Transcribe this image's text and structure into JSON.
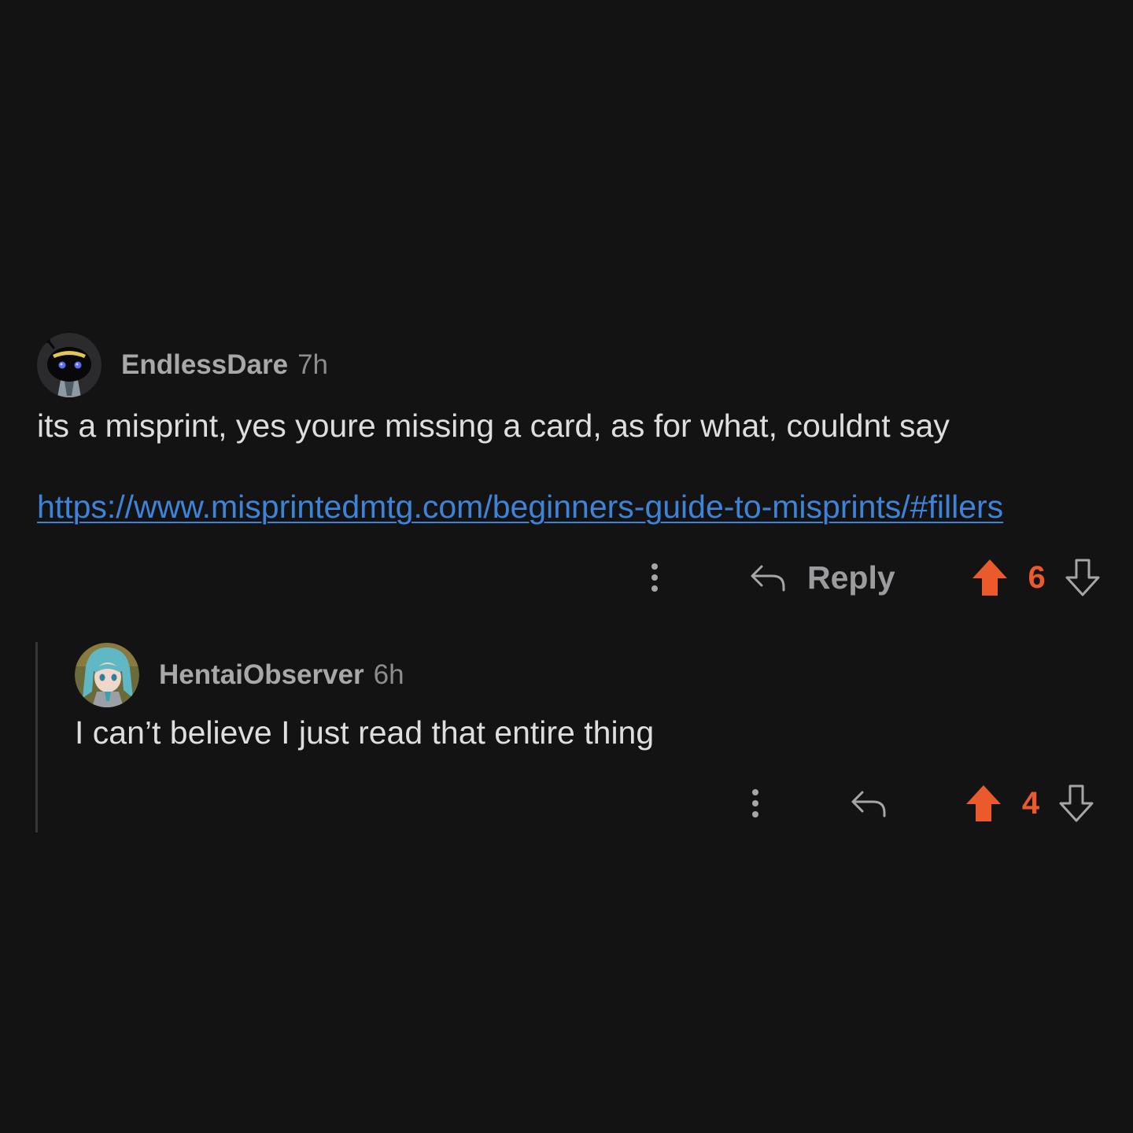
{
  "comments": [
    {
      "username": "EndlessDare",
      "timestamp": "7h",
      "body": "its a misprint, yes youre missing a card, as for what, couldnt say",
      "link": "https://www.misprintedmtg.com/beginners-guide-to-misprints/#fillers",
      "reply_label": "Reply",
      "votes": "6",
      "avatar_icon": "snoo-avatar-icon"
    },
    {
      "username": "HentaiObserver",
      "timestamp": "6h",
      "body": "I can’t believe I just read that entire thing",
      "votes": "4",
      "avatar_icon": "anime-character-avatar-icon"
    }
  ],
  "colors": {
    "background": "#131314",
    "upvote_active": "#ea5a2a",
    "link": "#3f83d9",
    "muted": "#9c9c9f"
  }
}
